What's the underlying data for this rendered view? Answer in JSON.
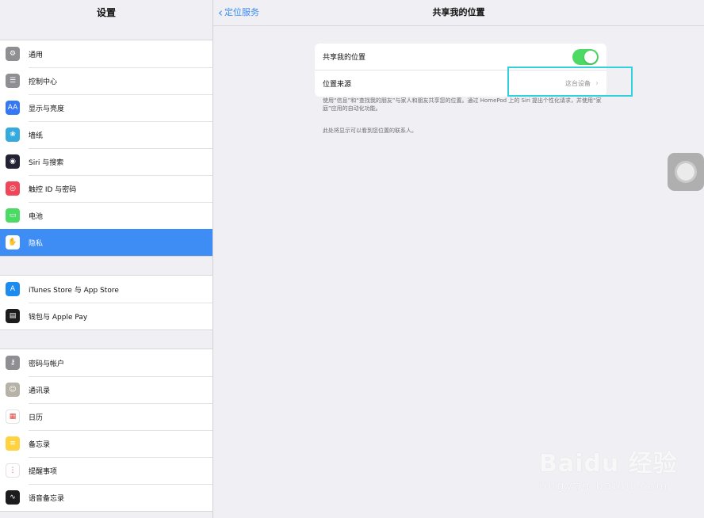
{
  "sidebar": {
    "title": "设置",
    "groups": [
      [
        {
          "label": "通用",
          "icon": "gear-icon",
          "color": "#8e8e93",
          "glyph": "⚙"
        },
        {
          "label": "控制中心",
          "icon": "control-center-icon",
          "color": "#8e8e93",
          "glyph": "☰"
        },
        {
          "label": "显示与亮度",
          "icon": "display-brightness-icon",
          "color": "#3478f6",
          "glyph": "AA"
        },
        {
          "label": "墙纸",
          "icon": "wallpaper-icon",
          "color": "#35aadc",
          "glyph": "❀"
        },
        {
          "label": "Siri 与搜索",
          "icon": "siri-icon",
          "color": "#222233",
          "glyph": "◉"
        },
        {
          "label": "触控 ID 与密码",
          "icon": "touch-id-icon",
          "color": "#f0465a",
          "glyph": "◎"
        },
        {
          "label": "电池",
          "icon": "battery-icon",
          "color": "#4cd964",
          "glyph": "▭"
        },
        {
          "label": "隐私",
          "icon": "privacy-hand-icon",
          "color": "#3478f6",
          "glyph": "✋"
        }
      ],
      [
        {
          "label": "iTunes Store 与 App Store",
          "icon": "app-store-icon",
          "color": "#1d8cf0",
          "glyph": "A"
        },
        {
          "label": "钱包与 Apple Pay",
          "icon": "wallet-icon",
          "color": "#1c1c1e",
          "glyph": "▤"
        }
      ],
      [
        {
          "label": "密码与帐户",
          "icon": "key-icon",
          "color": "#8e8e93",
          "glyph": "⚷"
        },
        {
          "label": "通讯录",
          "icon": "contacts-icon",
          "color": "#b7b2a8",
          "glyph": "☺"
        },
        {
          "label": "日历",
          "icon": "calendar-icon",
          "color": "#ffffff",
          "glyph": "▦"
        },
        {
          "label": "备忘录",
          "icon": "notes-icon",
          "color": "#ffd23f",
          "glyph": "≡"
        },
        {
          "label": "提醒事项",
          "icon": "reminders-icon",
          "color": "#ffffff",
          "glyph": "⋮"
        },
        {
          "label": "语音备忘录",
          "icon": "voice-memos-icon",
          "color": "#1c1c1e",
          "glyph": "∿"
        }
      ]
    ],
    "selected_label": "隐私"
  },
  "nav": {
    "back_label": "定位服务",
    "title": "共享我的位置"
  },
  "settings": {
    "share_label": "共享我的位置",
    "share_on": true,
    "source_label": "位置来源",
    "source_value": "这台设备",
    "footnote": "使用“信息”和“查找我的朋友”与家人和朋友共享您的位置。通过 HomePod 上的 Siri 提出个性化请求，并使用“家庭”应用的自动化功能。",
    "footnote2": "此处将显示可以看到您位置的联系人。"
  },
  "watermark": {
    "main": "Baidu 经验",
    "sub": "jingyan.baidu.com"
  },
  "colors": {
    "accent": "#3d8df5",
    "toggle_on": "#4cd964",
    "highlight": "#30d0dd"
  }
}
